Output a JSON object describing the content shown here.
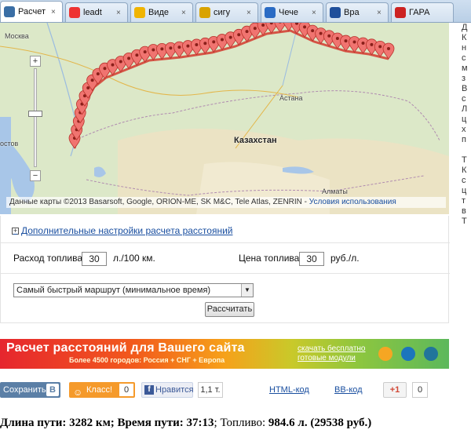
{
  "tabs": [
    {
      "label": "Расчет",
      "icon": "sphere-icon",
      "color": "#3a6ea5",
      "active": true
    },
    {
      "label": "leadt",
      "icon": "yandex-icon",
      "color": "#e33"
    },
    {
      "label": "Виде",
      "icon": "video-icon",
      "color": "#f0b400"
    },
    {
      "label": "сигу",
      "icon": "doc-icon",
      "color": "#d9a300"
    },
    {
      "label": "Чече",
      "icon": "page-icon",
      "color": "#2a6bc4"
    },
    {
      "label": "Вра",
      "icon": "globe-icon",
      "color": "#1f4f9b"
    },
    {
      "label": "ГАРА",
      "icon": "flag-icon",
      "color": "#c22"
    }
  ],
  "map": {
    "labels": {
      "moscow": "Москва",
      "rostov": "остов",
      "kazakhstan": "Казахстан",
      "astana": "Астана",
      "almaty": "Алматы"
    },
    "zoom_in": "+",
    "zoom_out": "−",
    "attribution": "Данные карты ©2013 Basarsoft, Google, ORION-ME, SK M&C, Tele Atlas, ZENRIN - ",
    "terms_link": "Условия использования"
  },
  "rightstrip": "Д\nК\nн\nс\nм\nз\nВ\nс\nЛ\nц\nх\nп\n\nТ\nК\nс\nц\nт\nв\nТ",
  "form": {
    "advanced_link": "Дополнительные настройки расчета расстояний",
    "fuel_label": "Расход топлива",
    "fuel_value": "30",
    "fuel_unit": "л./100 км.",
    "price_label": "Цена топлива",
    "price_value": "30",
    "price_unit": "руб./л.",
    "route_option": "Самый быстрый маршрут (минимальное время)",
    "calculate": "Рассчитать"
  },
  "banner": {
    "title": "Расчет расстояний для Вашего сайта",
    "subtitle": "Более 4500 городов: Россия + СНГ + Европа",
    "link1": "скачать бесплатно",
    "link2": "готовые модули"
  },
  "share": {
    "vk": "Сохранить",
    "vk_badge": "В",
    "ok": "Класс!",
    "ok_count": "0",
    "fb": "Нравится",
    "fb_count": "1,1 т.",
    "html_code": "HTML-код",
    "bb_code": "ВВ-код",
    "gplus": "+1",
    "gplus_count": "0"
  },
  "result": {
    "length_label": "Длина пути: ",
    "length_value": "3282 км",
    "time_label": "; Время пути: ",
    "time_value": "37:13",
    "fuel_label": "; Топливо: ",
    "fuel_value": "984.6 л.",
    "cost_value": " (29538 руб.)"
  }
}
